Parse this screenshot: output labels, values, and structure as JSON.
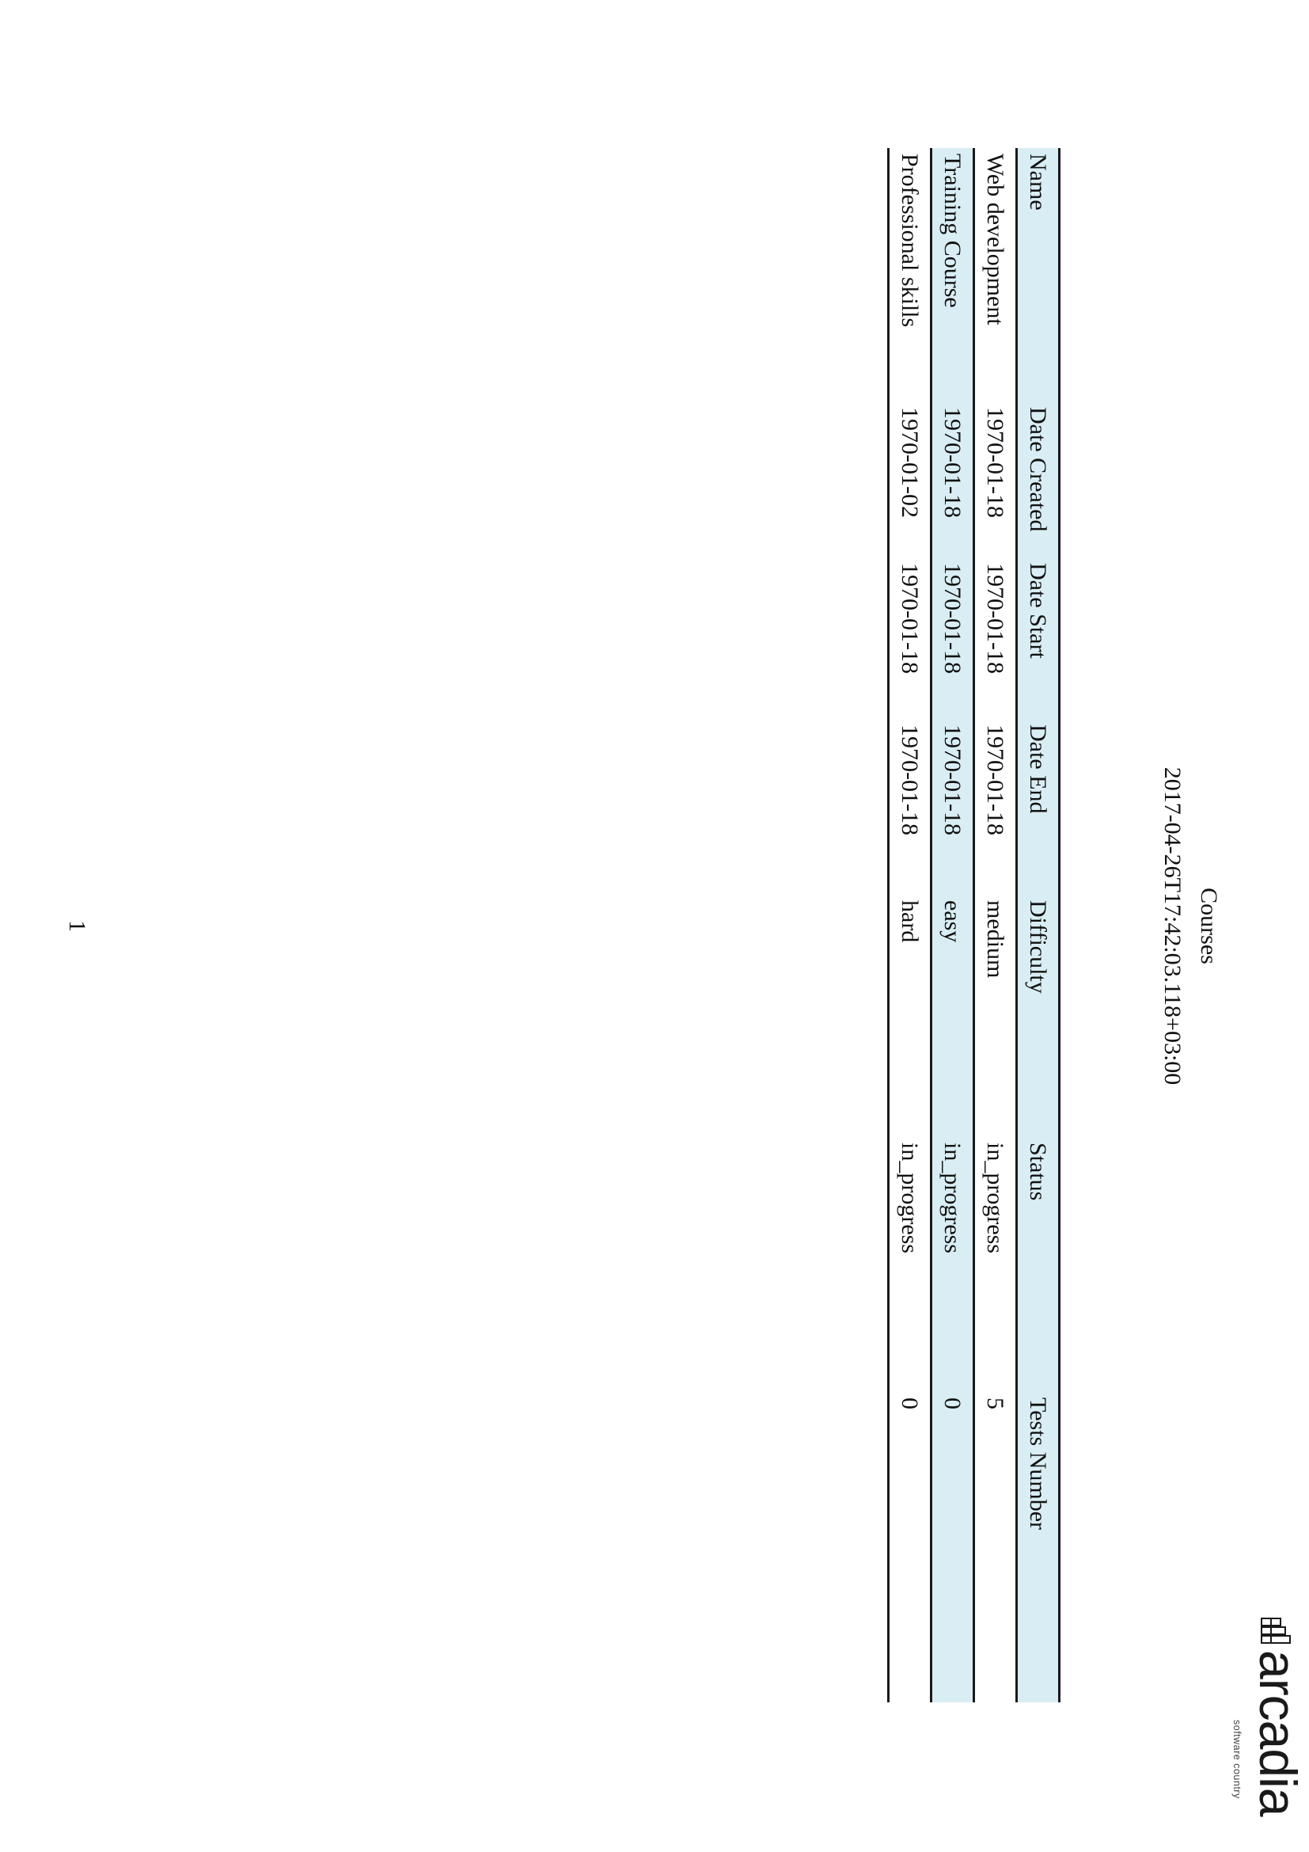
{
  "brand": {
    "name": "arcadia",
    "tagline": "software country"
  },
  "report": {
    "title": "Courses",
    "generated": "2017-04-26T17:42:03.118+03:00"
  },
  "table": {
    "columns": [
      "Name",
      "Date Created",
      "Date Start",
      "Date End",
      "Difficulty",
      "Status",
      "Tests Number"
    ],
    "rows": [
      [
        "Web development",
        "1970-01-18",
        "1970-01-18",
        "1970-01-18",
        "medium",
        "in_progress",
        "5"
      ],
      [
        "Training Course",
        "1970-01-18",
        "1970-01-18",
        "1970-01-18",
        "easy",
        "in_progress",
        "0"
      ],
      [
        "Professional skills",
        "1970-01-02",
        "1970-01-18",
        "1970-01-18",
        "hard",
        "in_progress",
        "0"
      ]
    ]
  },
  "footer": {
    "page_number": "1"
  },
  "colors": {
    "header_row_background": "#d9eef4",
    "rule_color": "#1a1a1a"
  }
}
